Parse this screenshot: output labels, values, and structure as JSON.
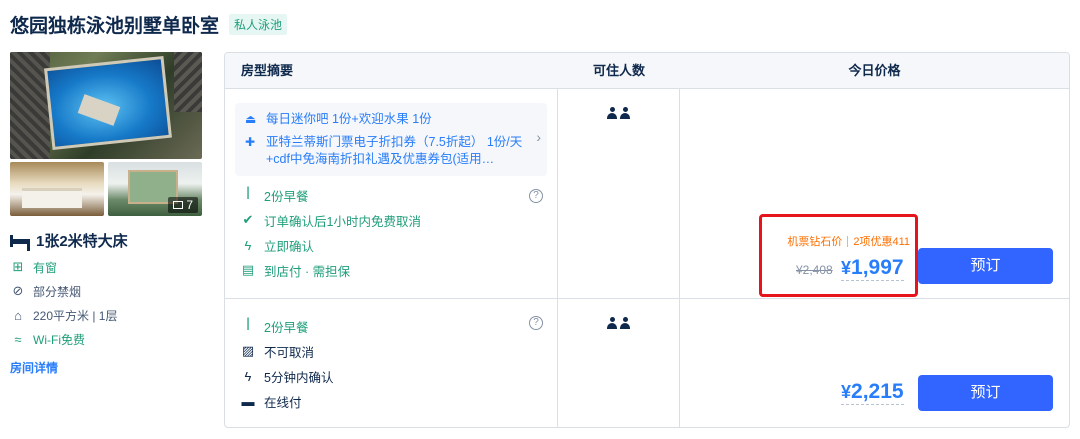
{
  "header": {
    "title": "悠园独栋泳池别墅单卧室",
    "tag": "私人泳池"
  },
  "gallery": {
    "photo_count": "7"
  },
  "room": {
    "bed": "1张2米特大床",
    "features": [
      {
        "icon": "window-icon",
        "glyph": "⊞",
        "text": "有窗",
        "green": true
      },
      {
        "icon": "no-smoking-icon",
        "glyph": "⊘",
        "text": "部分禁烟",
        "green": false
      },
      {
        "icon": "area-icon",
        "glyph": "⌂",
        "text": "220平方米 | 1层",
        "green": false
      },
      {
        "icon": "wifi-icon",
        "glyph": "≈",
        "text": "Wi-Fi免费",
        "green": true
      }
    ],
    "details_link": "房间详情"
  },
  "table": {
    "headers": {
      "summary": "房型摘要",
      "occupancy": "可住人数",
      "price": "今日价格"
    }
  },
  "rates": [
    {
      "perks": [
        {
          "icon": "minibar-icon",
          "glyph": "⛁",
          "text": "每日迷你吧 1份+欢迎水果 1份"
        },
        {
          "icon": "gift-icon",
          "glyph": "🎁",
          "text": "亚特兰蒂斯门票电子折扣券（7.5折起） 1份/天+cdf中免海南折扣礼遇及优惠券包(适用…"
        }
      ],
      "conditions": [
        {
          "icon": "meal-icon",
          "glyph": "Ⴤ",
          "text": "2份早餐",
          "green": true
        },
        {
          "icon": "check-circle-icon",
          "glyph": "✔",
          "text": "订单确认后1小时内免费取消",
          "green": true
        },
        {
          "icon": "lightning-icon",
          "glyph": "ϟ",
          "text": "立即确认",
          "green": true
        },
        {
          "icon": "pay-at-hotel-icon",
          "glyph": "▤",
          "text": "到店付 · 需担保",
          "green": true
        }
      ],
      "promo_label": "机票钻石价",
      "promo_discount": "2项优惠411",
      "original_price": "¥2,408",
      "currency": "¥",
      "price": "1,997",
      "book_label": "预订"
    },
    {
      "conditions": [
        {
          "icon": "meal-icon",
          "glyph": "Ⴤ",
          "text": "2份早餐",
          "green": true
        },
        {
          "icon": "no-cancel-icon",
          "glyph": "▨",
          "text": "不可取消",
          "green": false
        },
        {
          "icon": "lightning-icon",
          "glyph": "ϟ",
          "text": "5分钟内确认",
          "green": false
        },
        {
          "icon": "card-icon",
          "glyph": "▬",
          "text": "在线付",
          "green": false
        }
      ],
      "currency": "¥",
      "price": "2,215",
      "book_label": "预订"
    }
  ],
  "colors": {
    "accent": "#287dfa",
    "button": "#3264ff",
    "green": "#1f9e7a",
    "promo": "#ff6f00",
    "highlight": "#e6151c"
  }
}
